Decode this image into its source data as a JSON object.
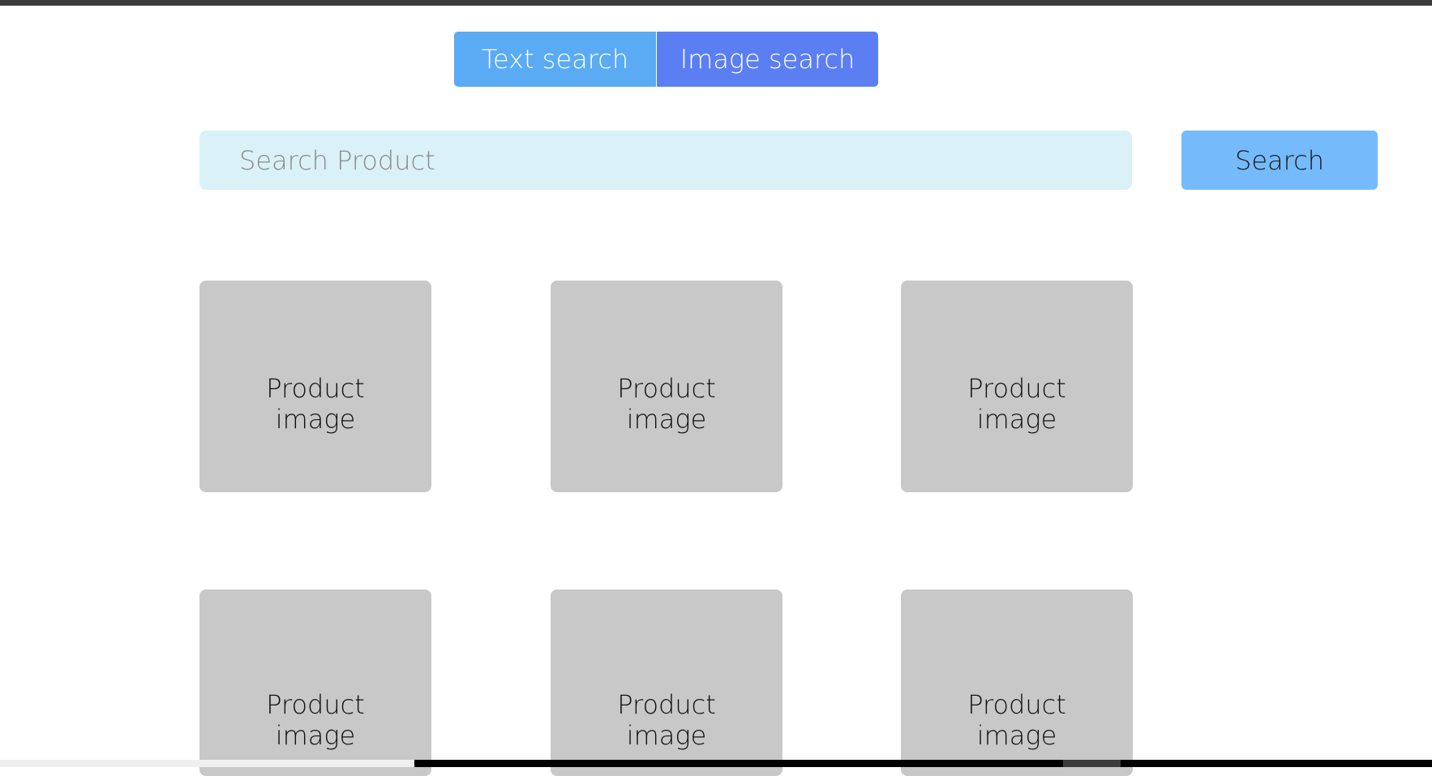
{
  "tabs": {
    "text_search_label": "Text search",
    "image_search_label": "Image search",
    "text_search_color": "#5aabf4",
    "image_search_color": "#5b7ff2"
  },
  "search": {
    "placeholder": "Search Product",
    "value": "",
    "button_label": "Search",
    "field_color": "#daf1f7",
    "button_color": "#75bbfb"
  },
  "products": [
    {
      "label": "Product\nimage"
    },
    {
      "label": "Product\nimage"
    },
    {
      "label": "Product\nimage"
    },
    {
      "label": "Product\nimage"
    },
    {
      "label": "Product\nimage"
    },
    {
      "label": "Product\nimage"
    }
  ],
  "product_placeholder_color": "#c8c8c8"
}
